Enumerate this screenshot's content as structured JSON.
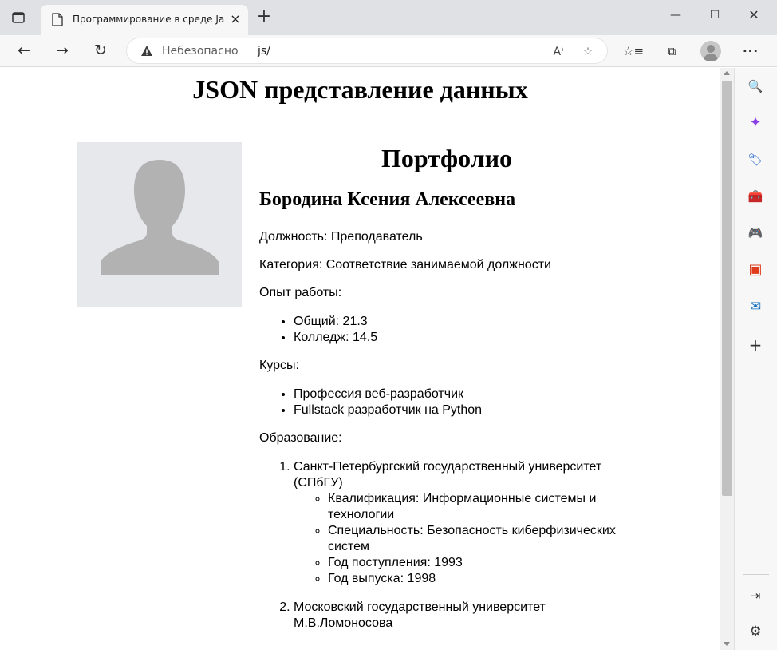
{
  "browser": {
    "tab_title": "Программирование в среде JavaScript",
    "tab_close": "×",
    "new_tab": "+",
    "window_controls": {
      "minimize": "—",
      "maximize": "☐",
      "close": "✕"
    },
    "nav": {
      "back": "←",
      "forward": "→",
      "reload": "↻"
    },
    "address": {
      "security_label": "Небезопасно",
      "url": "js/"
    },
    "icons": {
      "tab_actions": "tab-actions-icon",
      "page": "page-icon",
      "warning": "warning-triangle-icon",
      "read_aloud": "read-aloud-icon",
      "add_favorite": "add-favorite-icon",
      "favorites": "favorites-icon",
      "collections": "collections-icon",
      "profile": "profile-icon",
      "more": "more-icon"
    },
    "toolbar_glyphs": {
      "read_aloud": "A⁾",
      "add_favorite": "☆",
      "favorites": "☆≡",
      "collections": "⧉",
      "more": "···"
    },
    "sidebar_glyphs": {
      "search": "🔍",
      "copilot": "✦",
      "shopping": "🏷",
      "tools": "🧰",
      "games": "🎮",
      "office": "▣",
      "outlook": "✉",
      "add": "+",
      "hide_sidebar": "⇥",
      "settings": "⚙"
    }
  },
  "page": {
    "heading": "JSON представление данных",
    "portfolio": {
      "title": "Портфолио",
      "name": "Бородина Ксения Алексеевна",
      "position": "Должность: Преподаватель",
      "category": "Категория: Соответствие занимаемой должности",
      "experience_label": "Опыт работы:",
      "experience": [
        "Общий: 21.3",
        "Колледж: 14.5"
      ],
      "courses_label": "Курсы:",
      "courses": [
        "Профессия веб-разработчик",
        "Fullstack разработчик на Python"
      ],
      "education_label": "Образование:",
      "education": [
        {
          "name": "Санкт-Петербургский государственный университет (СПбГУ)",
          "details": [
            "Квалификация: Информационные системы и технологии",
            "Специальность: Безопасность киберфизических систем",
            "Год поступления: 1993",
            "Год выпуска: 1998"
          ]
        },
        {
          "name": "Московский государственный университет М.В.Ломоносова"
        }
      ]
    }
  },
  "colors": {
    "tabstrip": "#dfe1e5",
    "toolbar": "#f7f7f7",
    "photo_bg": "#e7e8ec",
    "silhouette": "#b2b2b2",
    "warning": "#3b3b3b"
  }
}
